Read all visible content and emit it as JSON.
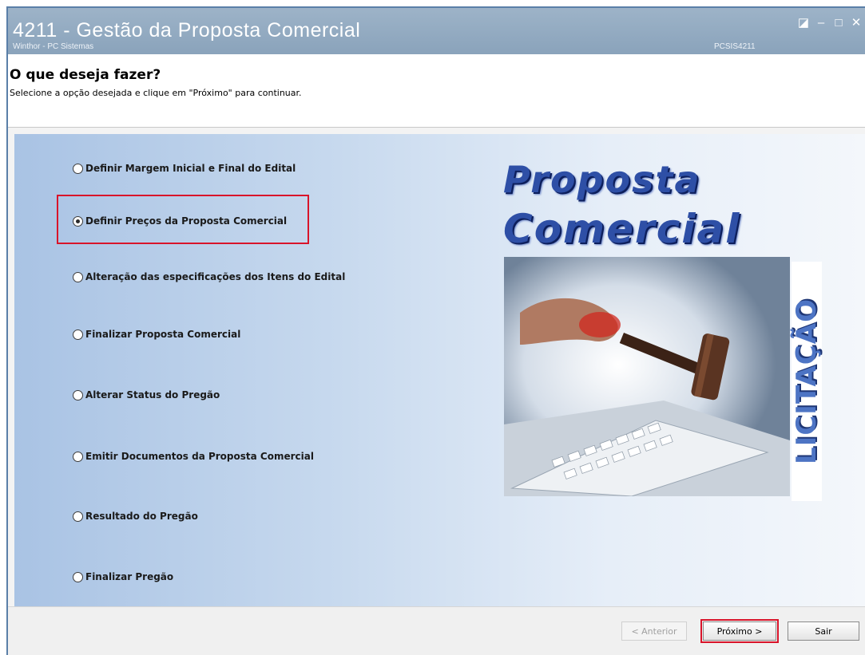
{
  "window": {
    "title": "4211 - Gestão da Proposta Comercial",
    "subtitle": "Winthor - PC Sistemas",
    "code": "PCSIS4211",
    "controls": {
      "restore": "◪",
      "minimize": "–",
      "maximize": "□",
      "close": "✕"
    }
  },
  "header": {
    "title": "O que deseja fazer?",
    "instruction": "Selecione a opção desejada e clique em \"Próximo\" para continuar."
  },
  "options": [
    {
      "label": "Definir Margem Inicial e Final do Edital",
      "selected": false
    },
    {
      "label": "Definir Preços da Proposta Comercial",
      "selected": true
    },
    {
      "label": "Alteração das especificações dos Itens do Edital",
      "selected": false
    },
    {
      "label": "Finalizar Proposta Comercial",
      "selected": false
    },
    {
      "label": "Alterar Status do Pregão",
      "selected": false
    },
    {
      "label": "Emitir Documentos da Proposta Comercial",
      "selected": false
    },
    {
      "label": "Resultado do Pregão",
      "selected": false
    },
    {
      "label": "Finalizar Pregão",
      "selected": false
    }
  ],
  "banner": {
    "line1": "Proposta",
    "line2": "Comercial",
    "side": "LICITAÇÃO"
  },
  "footer": {
    "prev_label": "< Anterior",
    "next_label": "Próximo >",
    "exit_label": "Sair"
  },
  "colors": {
    "accent": "#d9142a",
    "titlebar": "#94abc2",
    "banner_text": "#2e4fa6"
  }
}
